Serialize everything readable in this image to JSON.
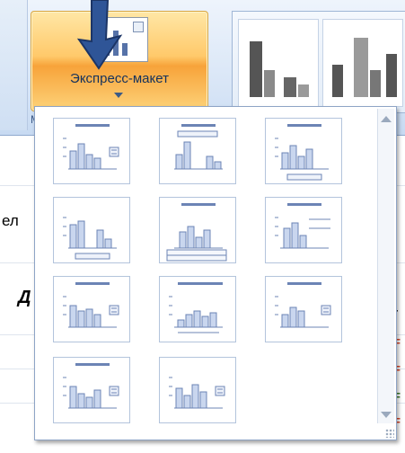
{
  "ribbon": {
    "quick_layout_label": "Экспресс-макет",
    "group_label_fragment": "М"
  },
  "sheet": {
    "text_fragment_1": "ел",
    "text_fragment_2": "Д",
    "right_fragments": [
      "i",
      "r",
      "F",
      "F",
      "F",
      "F"
    ]
  },
  "layouts": {
    "items": [
      "layout-1",
      "layout-2",
      "layout-3",
      "layout-4",
      "layout-5",
      "layout-6",
      "layout-7",
      "layout-8",
      "layout-9",
      "layout-10",
      "layout-11"
    ],
    "selected": "layout-1"
  },
  "colors": {
    "accent": "#4d6ea8",
    "highlight": "#ffc96a",
    "bar_fill": "#c9d6ee",
    "line": "#6c84b5",
    "text_fragment_red": "#d8462a"
  }
}
